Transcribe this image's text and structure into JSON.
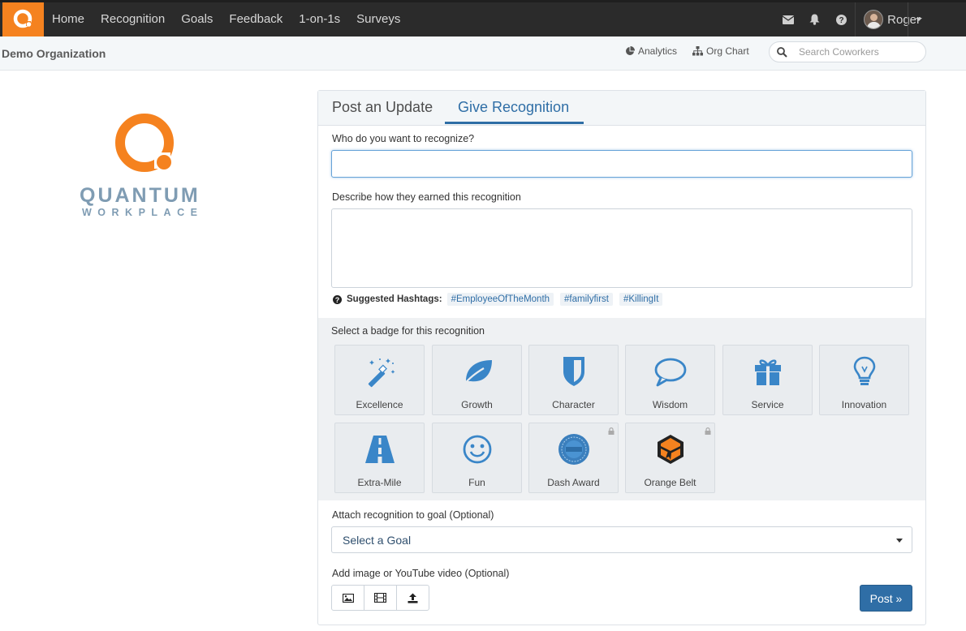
{
  "nav": {
    "items": [
      "Home",
      "Recognition",
      "Goals",
      "Feedback",
      "1-on-1s",
      "Surveys"
    ],
    "user_name": "Roger",
    "icons": [
      "envelope-icon",
      "bell-icon",
      "question-icon"
    ]
  },
  "subbar": {
    "org_name": "Demo Organization",
    "analytics_label": "Analytics",
    "orgchart_label": "Org Chart",
    "search_placeholder": "Search Coworkers"
  },
  "brand": {
    "word1": "QUANTUM",
    "word2": "WORKPLACE"
  },
  "tabs": {
    "post_update": "Post an Update",
    "give_recognition": "Give Recognition",
    "active": "give_recognition"
  },
  "form": {
    "who_label": "Who do you want to recognize?",
    "who_value": "",
    "describe_label": "Describe how they earned this recognition",
    "describe_value": "",
    "suggested_label": "Suggested Hashtags:",
    "hashtags": [
      "#EmployeeOfTheMonth",
      "#familyfirst",
      "#KillingIt"
    ],
    "badge_label": "Select a badge for this recognition",
    "badges": [
      {
        "name": "Excellence",
        "icon": "magic-wand-icon",
        "locked": false
      },
      {
        "name": "Growth",
        "icon": "leaf-icon",
        "locked": false
      },
      {
        "name": "Character",
        "icon": "shield-icon",
        "locked": false
      },
      {
        "name": "Wisdom",
        "icon": "speech-bubble-icon",
        "locked": false
      },
      {
        "name": "Service",
        "icon": "gift-icon",
        "locked": false
      },
      {
        "name": "Innovation",
        "icon": "lightbulb-icon",
        "locked": false
      },
      {
        "name": "Extra-Mile",
        "icon": "road-icon",
        "locked": false
      },
      {
        "name": "Fun",
        "icon": "smiley-icon",
        "locked": false
      },
      {
        "name": "Dash Award",
        "icon": "dash-award-icon",
        "locked": true
      },
      {
        "name": "Orange Belt",
        "icon": "orange-belt-icon",
        "locked": true
      }
    ],
    "goal_label": "Attach recognition to goal (Optional)",
    "goal_value": "Select a Goal",
    "media_label": "Add image or YouTube video (Optional)",
    "post_label": "Post »"
  },
  "colors": {
    "accent": "#2f6ea6",
    "brand_orange": "#f5821f",
    "nav_bg": "#2b2b2b",
    "icon_blue": "#3a86c8"
  }
}
